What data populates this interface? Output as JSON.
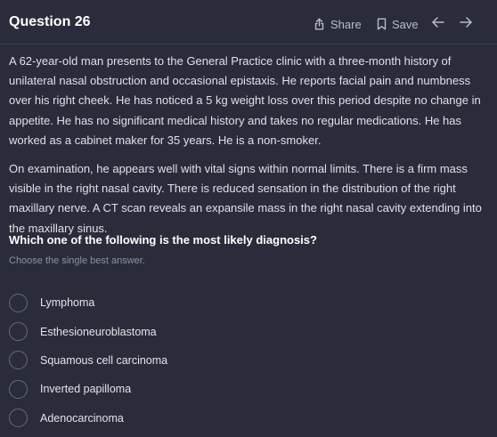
{
  "header": {
    "title": "Question 26",
    "share_label": "Share",
    "save_label": "Save",
    "icons": [
      "share-icon",
      "bookmark-icon",
      "arrow-left-icon",
      "arrow-right-icon"
    ]
  },
  "stem": {
    "paragraphs": [
      "A 62-year-old man presents to the General Practice clinic with a three-month history of unilateral nasal obstruction and occasional epistaxis. He reports facial pain and numbness over his right cheek. He has noticed a 5 kg weight loss over this period despite no change in appetite. He has no significant medical history and takes no regular medications. He has worked as a cabinet maker for 35 years. He is a non-smoker.",
      "On examination, he appears well with vital signs within normal limits. There is a firm mass visible in the right nasal cavity. There is reduced sensation in the distribution of the right maxillary nerve. A CT scan reveals an expansile mass in the right nasal cavity extending into the maxillary sinus."
    ]
  },
  "question": {
    "prompt": "Which one of the following is the most likely diagnosis?",
    "hint": "Choose the single best answer."
  },
  "options": [
    {
      "label": "Lymphoma"
    },
    {
      "label": "Esthesioneuroblastoma"
    },
    {
      "label": "Squamous cell carcinoma"
    },
    {
      "label": "Inverted papilloma"
    },
    {
      "label": "Adenocarcinoma"
    }
  ],
  "colors": {
    "background": "#2a2c3b",
    "text": "#dfe0ea",
    "muted": "#8e91a3",
    "radio_border": "#676a7d"
  }
}
